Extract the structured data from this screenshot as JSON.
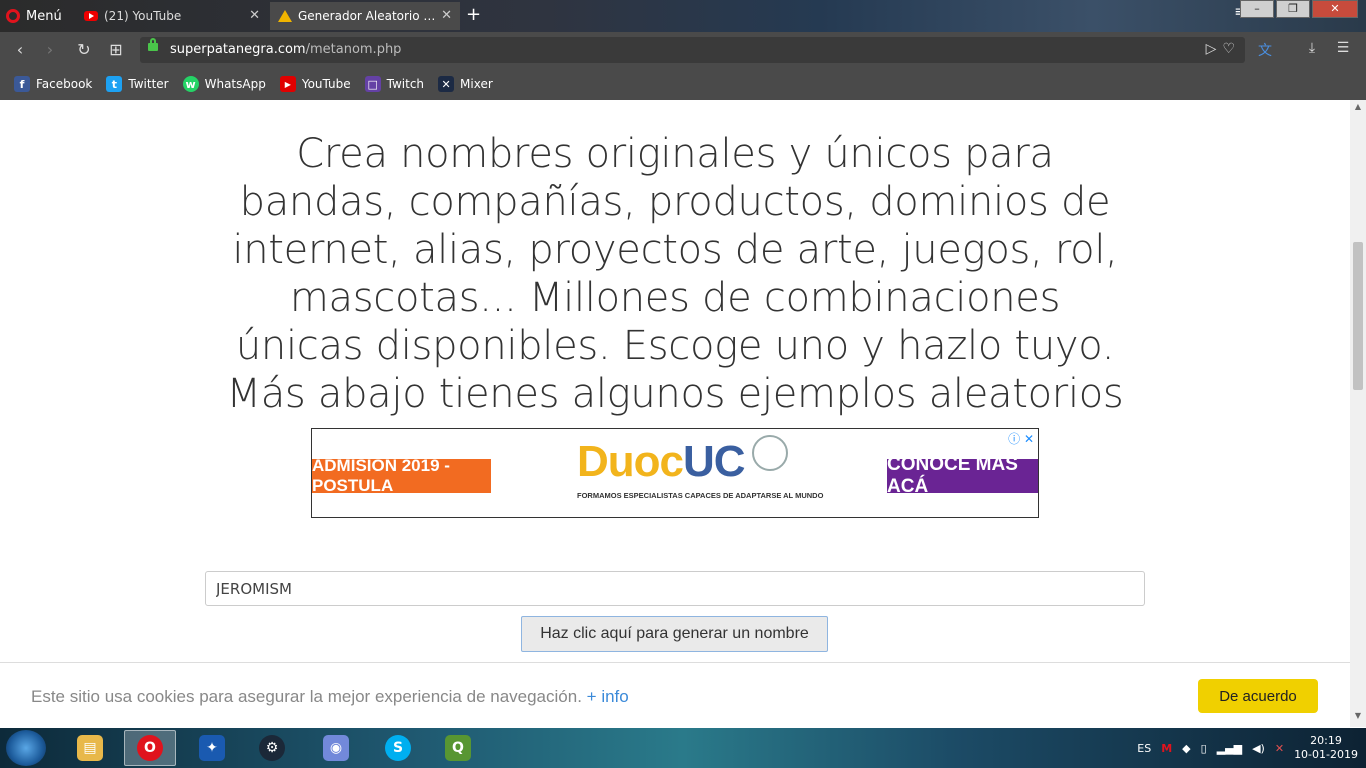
{
  "browser": {
    "menu_label": "Menú",
    "tabs": [
      {
        "title": "(21) YouTube"
      },
      {
        "title": "Generador Aleatorio de Nombres"
      }
    ],
    "url_host": "superpatanegra.com",
    "url_path": "/metanom.php",
    "window_controls": [
      "–",
      "❐",
      "✕"
    ]
  },
  "bookmarks": [
    {
      "label": "Facebook",
      "icon": "facebook-icon",
      "color": "#3b5998",
      "glyph": "f"
    },
    {
      "label": "Twitter",
      "icon": "twitter-icon",
      "color": "#1da1f2",
      "glyph": "t"
    },
    {
      "label": "WhatsApp",
      "icon": "whatsapp-icon",
      "color": "#25d366",
      "glyph": "w"
    },
    {
      "label": "YouTube",
      "icon": "youtube-icon",
      "color": "#e00000",
      "glyph": "▶"
    },
    {
      "label": "Twitch",
      "icon": "twitch-icon",
      "color": "#6441a5",
      "glyph": "□"
    },
    {
      "label": "Mixer",
      "icon": "mixer-icon",
      "color": "#1c2a44",
      "glyph": "✕"
    }
  ],
  "page": {
    "headline": "Crea nombres originales y únicos para bandas, compañías, productos, dominios de internet, alias, proyectos de arte, juegos, rol, mascotas... Millones de combinaciones únicas disponibles. Escoge uno y hazlo tuyo. Más abajo tienes algunos ejemplos aleatorios",
    "ad": {
      "left_text": "ADMISIÓN 2019 - POSTULA",
      "logo_main": "Duoc",
      "logo_accent": "UC",
      "tagline": "FORMAMOS ESPECIALISTAS CAPACES DE ADAPTARSE AL MUNDO",
      "right_text": "CONOCE MÁS ACÁ",
      "info_glyphs": "ⓘ ✕",
      "colors": {
        "orange": "#f26b21",
        "purple": "#6a2494",
        "gold": "#f2b41c",
        "blue": "#3a5fa0"
      }
    },
    "name_value": "JEROMISM",
    "generate_button": "Haz clic aquí para generar un nombre"
  },
  "cookie_banner": {
    "text": "Este sitio usa cookies para asegurar la mejor experiencia de navegación.",
    "link": "+ info",
    "accept": "De acuerdo"
  },
  "taskbar": {
    "apps": [
      {
        "name": "file-explorer-icon",
        "color": "#e8b84a",
        "glyph": "▤"
      },
      {
        "name": "opera-icon",
        "color": "#e0131d",
        "glyph": "O"
      },
      {
        "name": "battlenet-icon",
        "color": "#1a5ab0",
        "glyph": "✦"
      },
      {
        "name": "steam-icon",
        "color": "#1b2838",
        "glyph": "⚙"
      },
      {
        "name": "discord-icon",
        "color": "#7289da",
        "glyph": "◉"
      },
      {
        "name": "skype-icon",
        "color": "#00aff0",
        "glyph": "S"
      },
      {
        "name": "qgis-icon",
        "color": "#589632",
        "glyph": "Q"
      }
    ],
    "language": "ES",
    "time": "20:19",
    "date": "10-01-2019"
  }
}
